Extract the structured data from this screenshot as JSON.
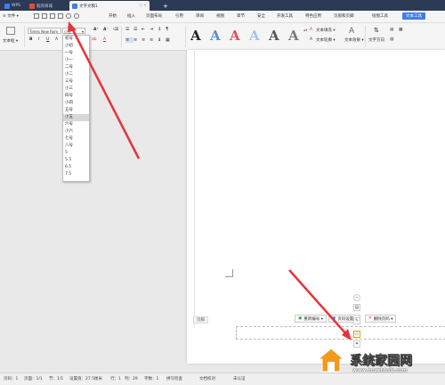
{
  "titlebar": {
    "tabs": [
      {
        "label": "WPS",
        "color": "#3f7dea"
      },
      {
        "label": "稻壳商城",
        "color": "#e8492e"
      },
      {
        "label": "文字文稿1",
        "color": "#3f7dea"
      }
    ],
    "add_tab": "+"
  },
  "menubar": {
    "file_label": "≡ 文件 ▾",
    "items": [
      "开始",
      "插入",
      "页面布局",
      "引用",
      "审阅",
      "视图",
      "章节",
      "安全",
      "开发工具",
      "特色应用",
      "页眉和页脚",
      "绘图工具",
      "文本工具"
    ]
  },
  "ribbon": {
    "textbox_label": "文本框 ▾",
    "font_name": "Times New Rom",
    "font_size": "小五",
    "wordart_letters": [
      "A",
      "A",
      "A",
      "A",
      "A",
      "A"
    ],
    "wordart_colors": [
      "#222222",
      "#5b8fd6",
      "#e05050",
      "#9fc3ee",
      "#555555",
      "#7a7a7a"
    ],
    "fill_label": "文本填充 ▾",
    "outline_label": "文本轮廓 ▾",
    "effect_label": "文本效果 ▾",
    "direction_label": "文字方向"
  },
  "fontsize_dropdown": {
    "items": [
      "初号",
      "小初",
      "一号",
      "小一",
      "二号",
      "小二",
      "三号",
      "小三",
      "四号",
      "小四",
      "五号",
      "小五",
      "六号",
      "小六",
      "七号",
      "八号",
      "5",
      "5.5",
      "6.5",
      "7.5"
    ],
    "selected": "小五"
  },
  "document": {
    "footer_label": "页脚",
    "footer_buttons": [
      "重新编号 ▾",
      "页码设置 ▾",
      "删除页码 ▾"
    ]
  },
  "statusbar": {
    "page": "页码：1",
    "pages": "页面：1/1",
    "section": "节：1/1",
    "setting": "设置值：27.5厘米",
    "row": "行：1",
    "col": "列：29",
    "chars": "字数：1",
    "spell": "拼写检查",
    "proof": "文档校对",
    "auth": "未认证"
  },
  "watermark": {
    "text": "系统家园网",
    "url": "www.hnzkhbsb.com"
  }
}
